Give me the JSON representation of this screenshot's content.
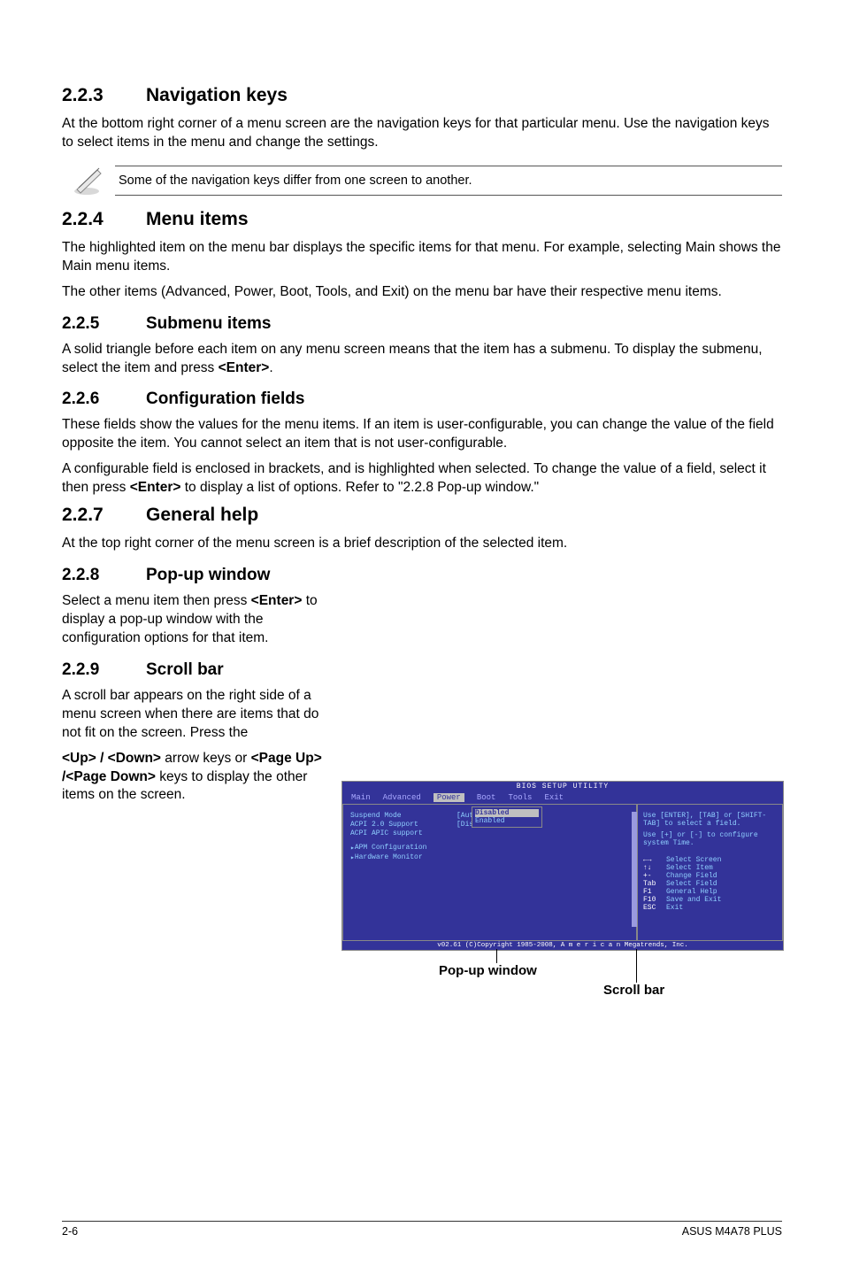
{
  "s223": {
    "num": "2.2.3",
    "title": "Navigation keys",
    "p1": "At the bottom right corner of a menu screen are the navigation keys for that particular menu. Use the navigation keys to select items in the menu and change the settings.",
    "note": "Some of the navigation keys differ from one screen to another."
  },
  "s224": {
    "num": "2.2.4",
    "title": "Menu items",
    "p1": "The highlighted item on the menu bar  displays the specific items for that menu. For example, selecting Main shows the Main menu items.",
    "p2": "The other items (Advanced, Power, Boot, Tools, and Exit) on the menu bar have their respective menu items."
  },
  "s225": {
    "num": "2.2.5",
    "title": "Submenu items",
    "p1_a": "A solid triangle before each item on any menu screen means that the item has a submenu. To display the submenu, select the item and press ",
    "p1_b": "<Enter>",
    "p1_c": "."
  },
  "s226": {
    "num": "2.2.6",
    "title": "Configuration fields",
    "p1": "These fields show the values for the menu items. If an item is user-configurable, you can change the value of the field opposite the item. You cannot select an item that is not user-configurable.",
    "p2_a": "A configurable field is enclosed in brackets, and is highlighted when selected. To change the value of a field, select it then press ",
    "p2_b": "<Enter>",
    "p2_c": " to display a list of options. Refer to \"2.2.8 Pop-up window.\""
  },
  "s227": {
    "num": "2.2.7",
    "title": "General help",
    "p1": "At the top right corner of the menu screen is a brief description of the selected item."
  },
  "s228": {
    "num": "2.2.8",
    "title": "Pop-up window",
    "p1_a": "Select a menu item then press ",
    "p1_b": "<Enter>",
    "p1_c": " to display a pop-up window with the configuration options for that item."
  },
  "s229": {
    "num": "2.2.9",
    "title": "Scroll bar",
    "p1": "A scroll bar appears on the right side of a menu screen when there are items that do not fit on the screen. Press the",
    "p2_a": "<Up> / <Down>",
    "p2_b": " arrow keys or ",
    "p2_c": "<Page Up> /<Page Down>",
    "p2_d": " keys to display the other items on the screen."
  },
  "bios": {
    "title": "BIOS SETUP UTILITY",
    "menus": [
      "Main",
      "Advanced",
      "Power",
      "Boot",
      "Tools",
      "Exit"
    ],
    "rows": [
      {
        "l": "Suspend Mode",
        "v": "[Auto]"
      },
      {
        "l": "ACPI 2.0 Support",
        "v": "[Disabled]"
      },
      {
        "l": "ACPI APIC support",
        "v": ""
      }
    ],
    "popup": {
      "opt1": "Disabled",
      "opt2": "Enabled"
    },
    "sub1": "APM Configuration",
    "sub2": "Hardware Monitor",
    "help1": "Use [ENTER], [TAB] or [SHIFT-TAB] to select a field.",
    "help2": "Use [+] or [-] to configure system Time.",
    "keys": [
      {
        "k": "←→",
        "d": "Select Screen"
      },
      {
        "k": "↑↓",
        "d": "Select Item"
      },
      {
        "k": "+-",
        "d": "Change Field"
      },
      {
        "k": "Tab",
        "d": "Select Field"
      },
      {
        "k": "F1",
        "d": "General Help"
      },
      {
        "k": "F10",
        "d": "Save and Exit"
      },
      {
        "k": "ESC",
        "d": "Exit"
      }
    ],
    "foot": "v02.61 (C)Copyright 1985-2008, A m e r i c a n Megatrends, Inc."
  },
  "callouts": {
    "popup": "Pop-up window",
    "scroll": "Scroll bar"
  },
  "footer": {
    "page": "2-6",
    "product": "ASUS M4A78 PLUS"
  }
}
